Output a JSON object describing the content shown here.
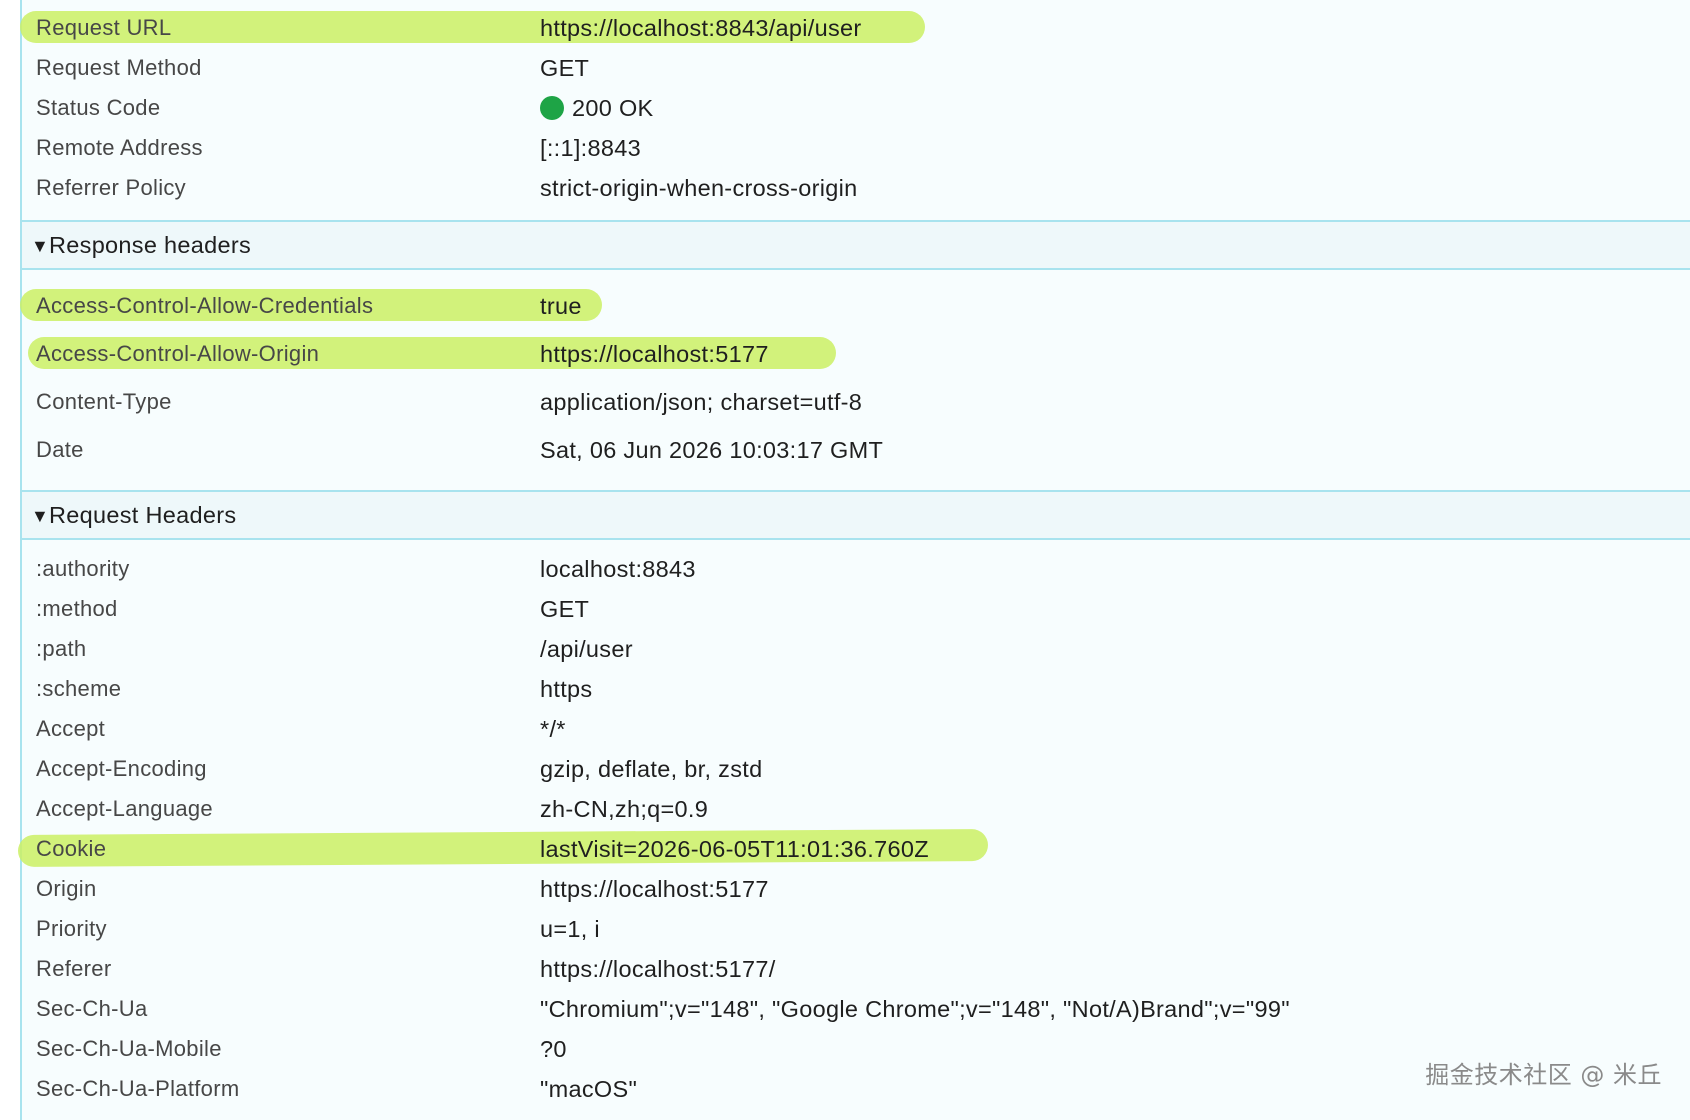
{
  "general": {
    "request_url_key": "Request URL",
    "request_url_val": "https://localhost:8843/api/user",
    "request_method_key": "Request Method",
    "request_method_val": "GET",
    "status_code_key": "Status Code",
    "status_code_val": "200 OK",
    "status_color": "#1ea446",
    "remote_address_key": "Remote Address",
    "remote_address_val": "[::1]:8843",
    "referrer_policy_key": "Referrer Policy",
    "referrer_policy_val": "strict-origin-when-cross-origin"
  },
  "response_headers": {
    "title": "Response headers",
    "acac_key": "Access-Control-Allow-Credentials",
    "acac_val": "true",
    "acao_key": "Access-Control-Allow-Origin",
    "acao_val": "https://localhost:5177",
    "content_type_key": "Content-Type",
    "content_type_val": "application/json; charset=utf-8",
    "date_key": "Date",
    "date_val": "Sat, 06 Jun 2026 10:03:17 GMT"
  },
  "request_headers": {
    "title": "Request Headers",
    "authority_key": ":authority",
    "authority_val": "localhost:8843",
    "method_key": ":method",
    "method_val": "GET",
    "path_key": ":path",
    "path_val": "/api/user",
    "scheme_key": ":scheme",
    "scheme_val": "https",
    "accept_key": "Accept",
    "accept_val": "*/*",
    "accept_encoding_key": "Accept-Encoding",
    "accept_encoding_val": "gzip, deflate, br, zstd",
    "accept_language_key": "Accept-Language",
    "accept_language_val": "zh-CN,zh;q=0.9",
    "cookie_key": "Cookie",
    "cookie_val": "lastVisit=2026-06-05T11:01:36.760Z",
    "origin_key": "Origin",
    "origin_val": "https://localhost:5177",
    "priority_key": "Priority",
    "priority_val": "u=1, i",
    "referer_key": "Referer",
    "referer_val": "https://localhost:5177/",
    "sec_ch_ua_key": "Sec-Ch-Ua",
    "sec_ch_ua_val": "\"Chromium\";v=\"148\", \"Google Chrome\";v=\"148\", \"Not/A)Brand\";v=\"99\"",
    "sec_ch_ua_mobile_key": "Sec-Ch-Ua-Mobile",
    "sec_ch_ua_mobile_val": "?0",
    "sec_ch_ua_platform_key": "Sec-Ch-Ua-Platform",
    "sec_ch_ua_platform_val": "\"macOS\""
  },
  "watermark": "掘金技术社区 @ 米丘",
  "highlight_color": "#cbf064"
}
